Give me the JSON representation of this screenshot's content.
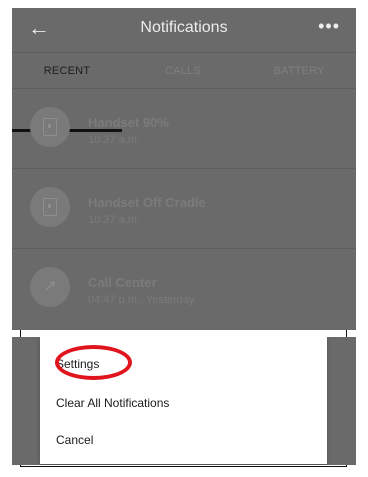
{
  "header": {
    "back_icon": "←",
    "title": "Notifications",
    "more_icon": "•••"
  },
  "tabs": [
    {
      "label": "RECENT",
      "active": true
    },
    {
      "label": "CALLS",
      "active": false
    },
    {
      "label": "BATTERY",
      "active": false
    }
  ],
  "notifications": [
    {
      "icon": "handset-icon",
      "title": "Handset 90%",
      "time": "10:37 a.m."
    },
    {
      "icon": "handset-icon",
      "title": "Handset Off Cradle",
      "time": "10:37 a.m."
    },
    {
      "icon": "outgoing-call-icon",
      "title": "Call Center",
      "time": "04:47 p.m., Yesterday"
    }
  ],
  "menu": {
    "items": [
      "Settings",
      "Clear All Notifications",
      "Cancel"
    ]
  },
  "colors": {
    "overlay": "#6a6a6a",
    "highlight_ring": "#e0141c"
  }
}
